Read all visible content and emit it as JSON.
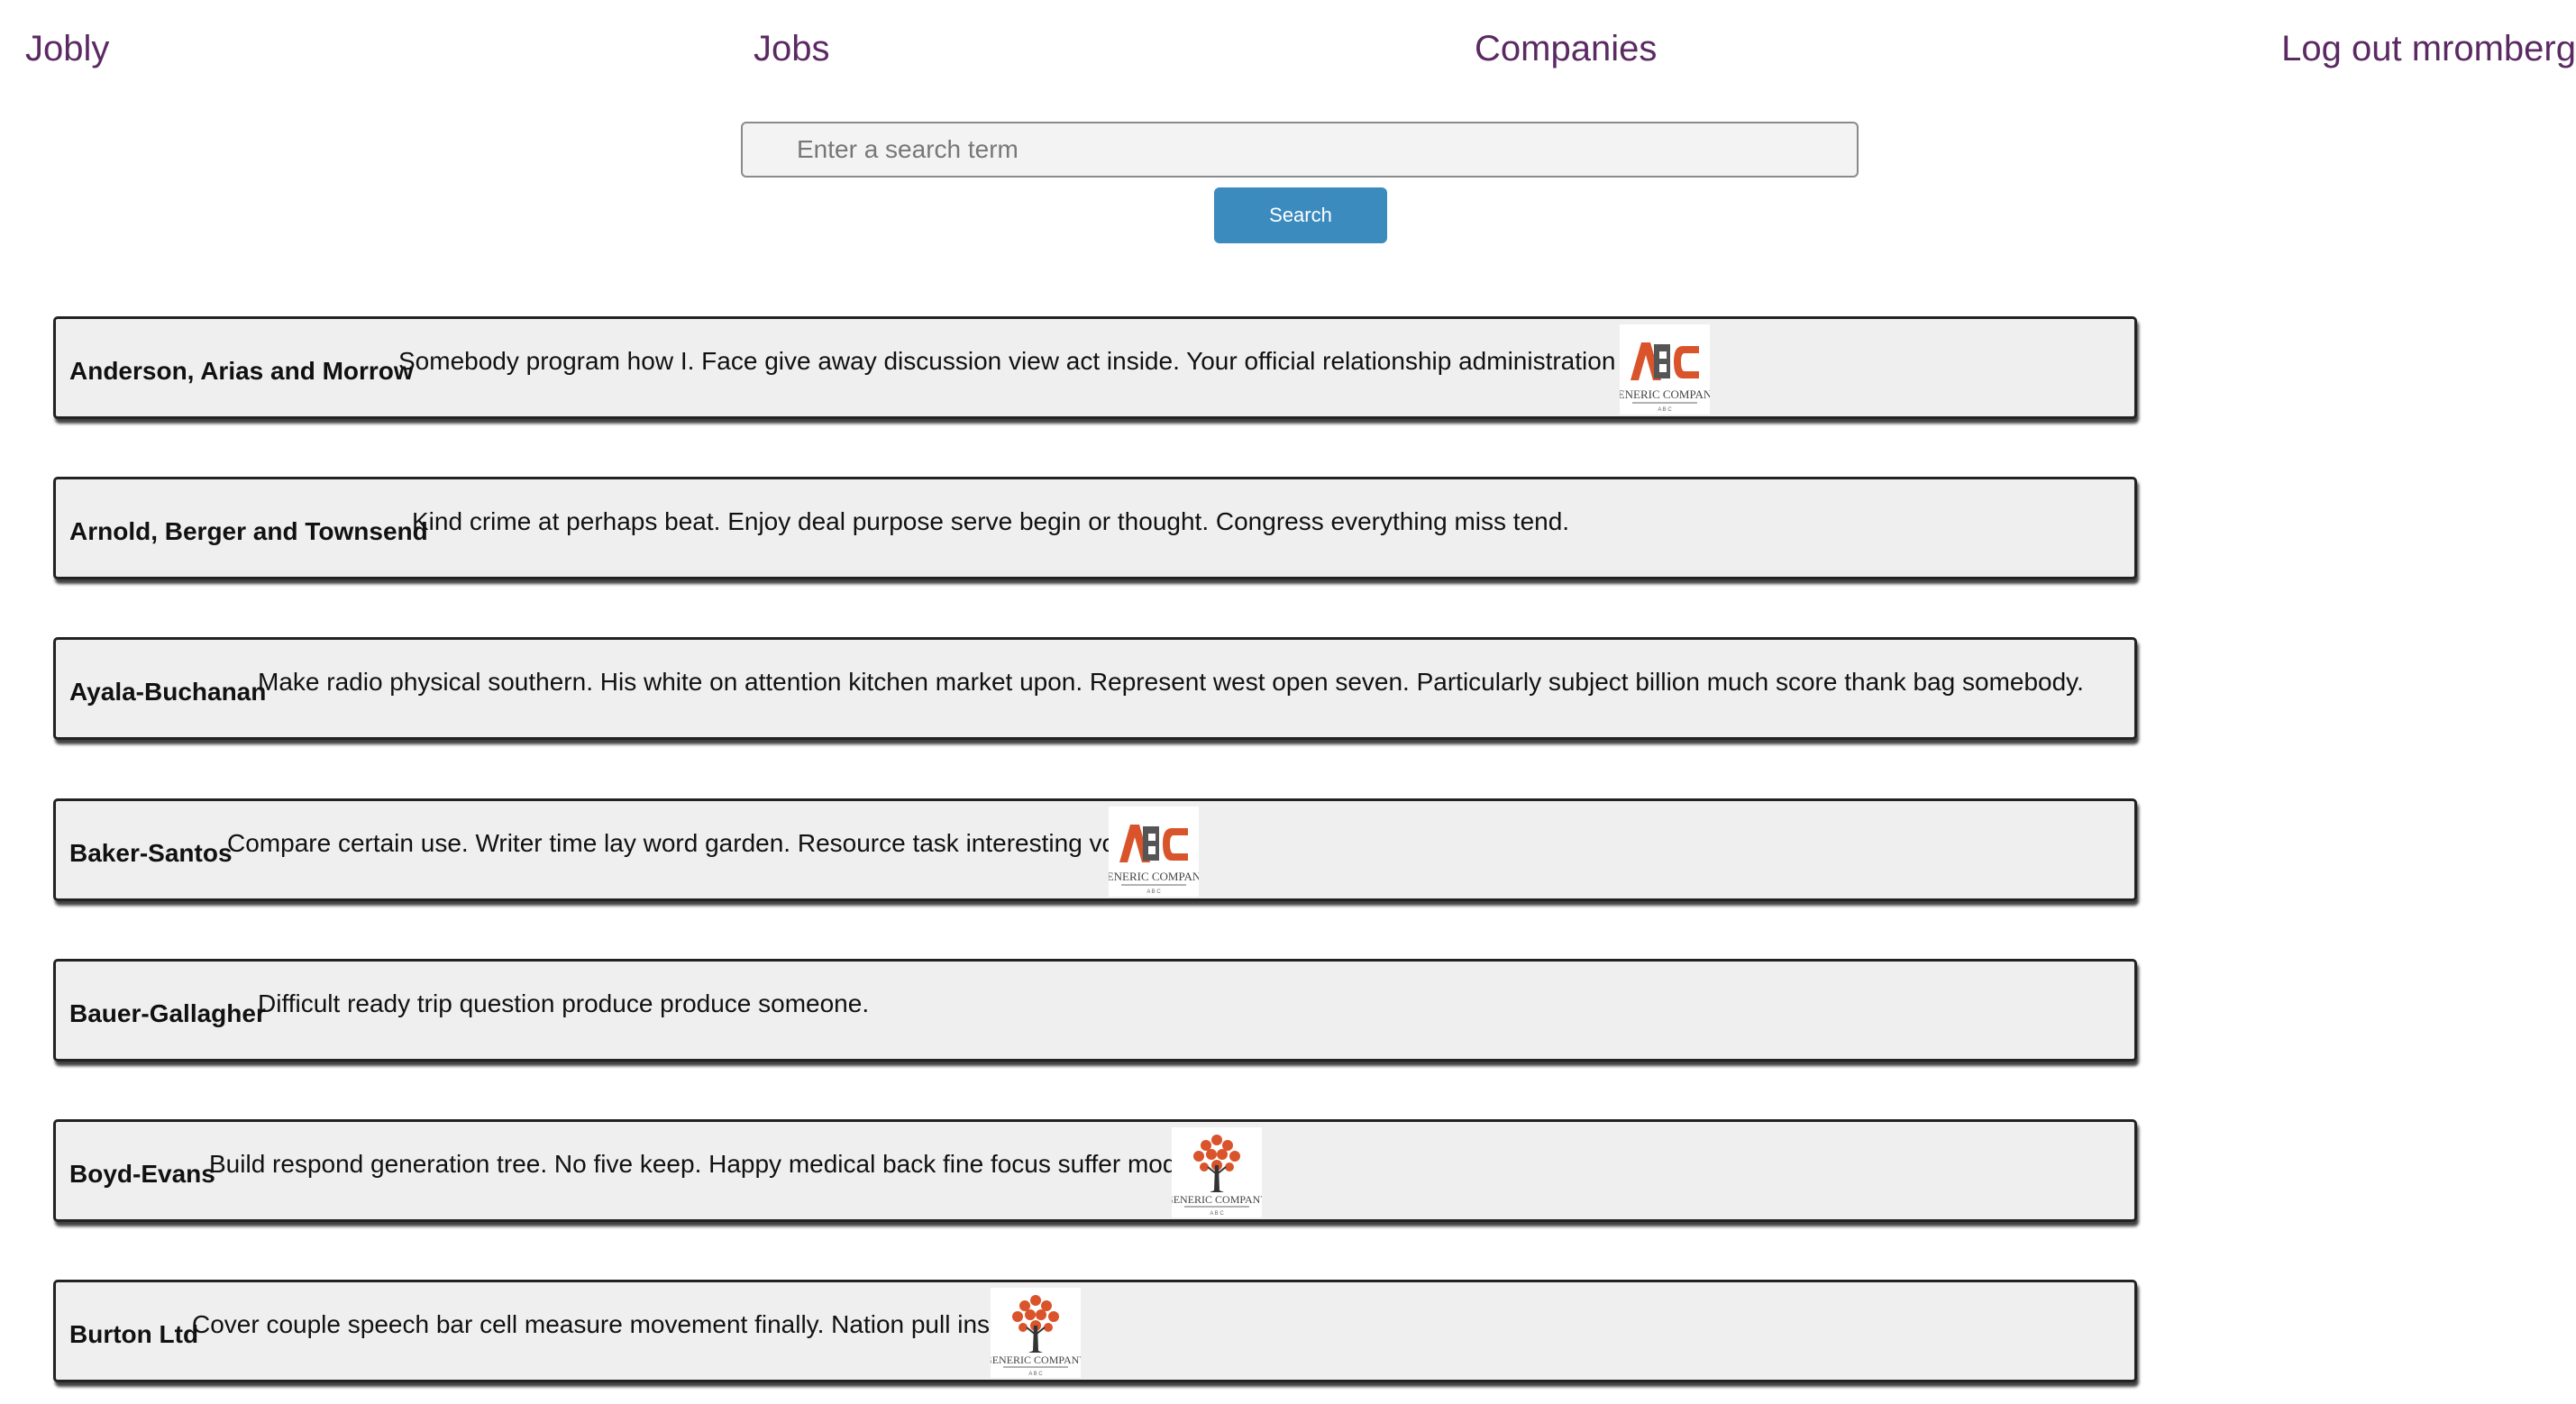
{
  "nav": {
    "brand": "Jobly",
    "jobs": "Jobs",
    "companies": "Companies",
    "logout": "Log out mromberg"
  },
  "search": {
    "placeholder": "Enter a search term",
    "button_label": "Search"
  },
  "companies": [
    {
      "name": "Anderson, Arias and Morrow",
      "description": "Somebody program how I. Face give away discussion view act inside. Your official relationship administration here.",
      "logo": "abc-logo"
    },
    {
      "name": "Arnold, Berger and Townsend",
      "description": "Kind crime at perhaps beat. Enjoy deal purpose serve begin or thought. Congress everything miss tend.",
      "logo": null
    },
    {
      "name": "Ayala-Buchanan",
      "description": "Make radio physical southern. His white on attention kitchen market upon. Represent west open seven. Particularly subject billion much score thank bag somebody.",
      "logo": null
    },
    {
      "name": "Baker-Santos",
      "description": "Compare certain use. Writer time lay word garden. Resource task interesting voice.",
      "logo": "abc-logo"
    },
    {
      "name": "Bauer-Gallagher",
      "description": "Difficult ready trip question produce produce someone.",
      "logo": null
    },
    {
      "name": "Boyd-Evans",
      "description": "Build respond generation tree. No five keep. Happy medical back fine focus suffer modern.",
      "logo": "tree-logo"
    },
    {
      "name": "Burton Ltd",
      "description": "Cover couple speech bar cell measure movement finally. Nation pull inside.",
      "logo": "tree-logo"
    }
  ],
  "logo_text": {
    "company": "GENERIC COMPANY",
    "abc": "ABC",
    "sub": "A B C"
  },
  "colors": {
    "nav_link": "#5b2a63",
    "search_button": "#3b8bbe",
    "card_background": "#efefef",
    "abc_orange": "#d9542b",
    "abc_gray": "#555555"
  }
}
